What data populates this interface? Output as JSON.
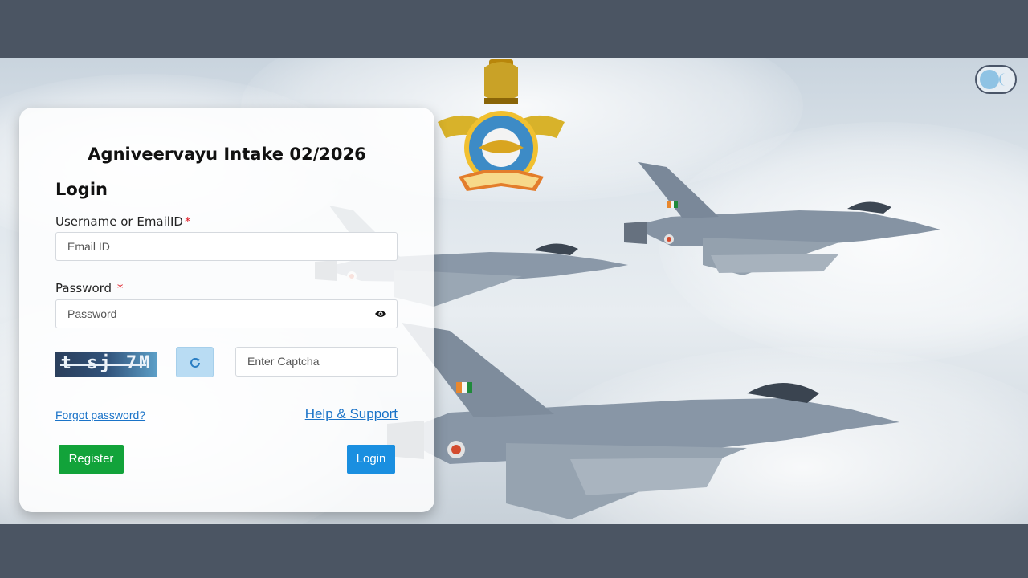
{
  "header": {
    "title": "Agniveervayu Intake 02/2026"
  },
  "login": {
    "heading": "Login",
    "username_label": "Username or EmailID",
    "username_placeholder": "Email ID",
    "password_label": "Password",
    "password_placeholder": "Password",
    "required_marker": "*",
    "captcha_text": "t sj 7M",
    "captcha_placeholder": "Enter Captcha",
    "forgot_password": "Forgot password?",
    "help_support": "Help & Support",
    "register_button": "Register",
    "login_button": "Login"
  },
  "icons": {
    "emblem": "iaf-emblem-icon",
    "theme_toggle": "theme-toggle",
    "eye": "eye-icon",
    "refresh": "refresh-icon"
  },
  "colors": {
    "page_frame": "#4b5563",
    "register": "#12a33a",
    "login": "#1a8fe0",
    "required": "#e0202a",
    "link": "#1a73c8"
  }
}
